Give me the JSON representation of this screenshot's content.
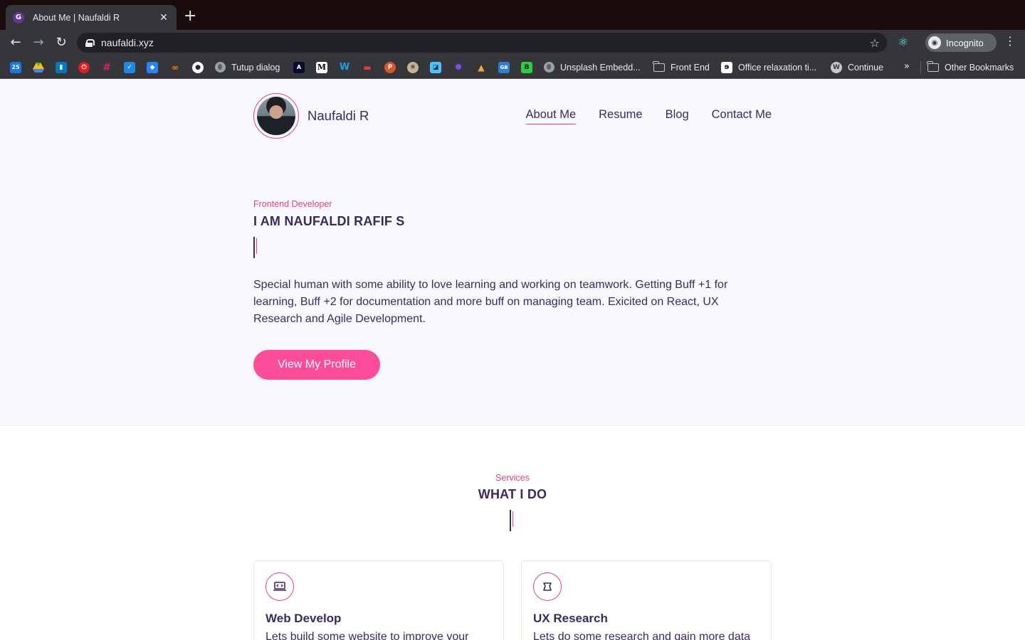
{
  "browser": {
    "tab": {
      "title": "About Me | Naufaldi R",
      "favicon": "G"
    },
    "url": "naufaldi.xyz",
    "profile_label": "Incognito",
    "bookmarks": [
      {
        "label": "Tutup dialog"
      },
      {
        "label": "Unsplash Embedd..."
      },
      {
        "label": "Front End"
      },
      {
        "label": "Office relaxation ti..."
      },
      {
        "label": "Continue"
      }
    ],
    "other_bookmarks": "Other Bookmarks",
    "calendar_date": "25"
  },
  "site": {
    "brand": "Naufaldi R",
    "nav": [
      "About Me",
      "Resume",
      "Blog",
      "Contact Me"
    ],
    "hero": {
      "eyebrow": "Frontend Developer",
      "title": "I AM NAUFALDI RAFIF S",
      "text": "Special human with some ability to love learning and working on teamwork. Getting Buff +1 for learning, Buff +2 for documentation and more buff on managing team. Exicited on React, UX Research and Agile Development.",
      "cta": "View My Profile"
    },
    "services": {
      "eyebrow": "Services",
      "title": "WHAT I DO",
      "cards": [
        {
          "title": "Web Develop",
          "text": "Lets build some website to improve your",
          "icon": "laptop-code-icon"
        },
        {
          "title": "UX Research",
          "text": "Lets do some research and gain more data",
          "icon": "research-icon"
        }
      ]
    }
  },
  "colors": {
    "accent": "#e83e8c",
    "cta": "#fd4c9a",
    "text": "#3a2a5e",
    "hero_bg": "#f7f9fc"
  }
}
